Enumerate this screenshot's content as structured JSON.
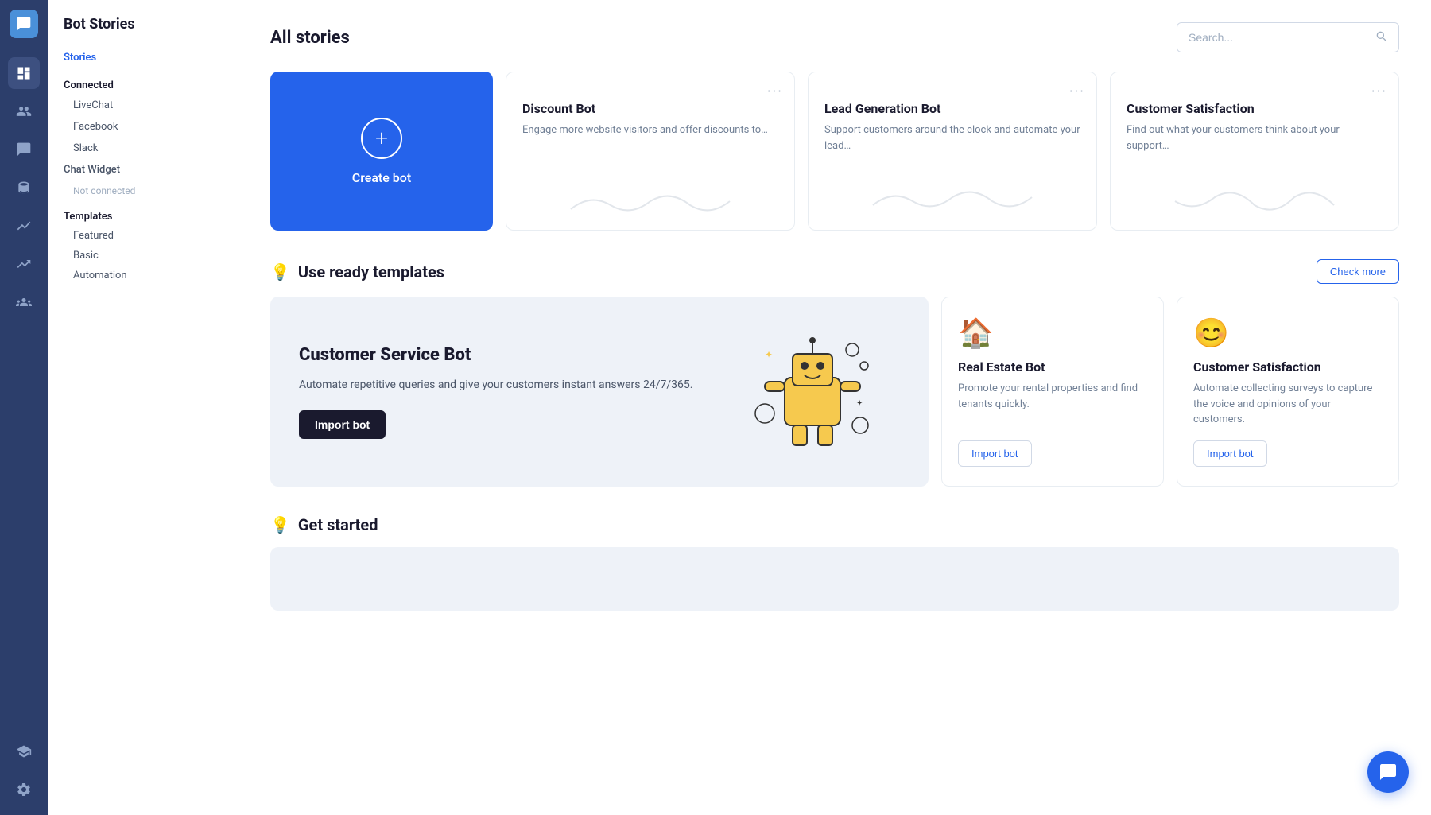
{
  "app": {
    "title": "Bot Stories"
  },
  "icon_sidebar": {
    "items": [
      {
        "name": "dashboard-icon",
        "label": "Dashboard"
      },
      {
        "name": "users-icon",
        "label": "Users"
      },
      {
        "name": "chat-icon",
        "label": "Chat"
      },
      {
        "name": "database-icon",
        "label": "Database"
      },
      {
        "name": "analytics-icon",
        "label": "Analytics"
      },
      {
        "name": "growth-icon",
        "label": "Growth"
      },
      {
        "name": "team-icon",
        "label": "Team"
      },
      {
        "name": "education-icon",
        "label": "Education"
      },
      {
        "name": "settings-icon",
        "label": "Settings"
      }
    ]
  },
  "nav_sidebar": {
    "title": "Bot Stories",
    "stories_label": "Stories",
    "connected_label": "Connected",
    "connected_items": [
      "LiveChat",
      "Facebook",
      "Slack"
    ],
    "not_connected_label": "Chat Widget",
    "not_connected_sub": "Not connected",
    "templates_label": "Templates",
    "template_items": [
      "Featured",
      "Basic",
      "Automation"
    ]
  },
  "main": {
    "all_stories_title": "All stories",
    "search_placeholder": "Search...",
    "create_bot_label": "Create bot",
    "bot_cards": [
      {
        "title": "Discount Bot",
        "desc": "Engage more website visitors and offer discounts to…"
      },
      {
        "title": "Lead Generation Bot",
        "desc": "Support customers around the clock and automate your lead…"
      },
      {
        "title": "Customer Satisfaction",
        "desc": "Find out what your customers think about your support…"
      }
    ],
    "templates_section_title": "Use ready templates",
    "check_more_label": "Check more",
    "featured_card": {
      "title": "Customer Service Bot",
      "desc": "Automate repetitive queries and give your customers instant answers 24/7/365.",
      "import_label": "Import bot"
    },
    "template_cards": [
      {
        "icon": "🏠",
        "title": "Real Estate Bot",
        "desc": "Promote your rental properties and find tenants quickly.",
        "import_label": "Import bot"
      },
      {
        "icon": "😊",
        "title": "Customer Satisfaction",
        "desc": "Automate collecting surveys to capture the voice and opinions of your customers.",
        "import_label": "Import bot"
      }
    ],
    "get_started_title": "Get started"
  }
}
